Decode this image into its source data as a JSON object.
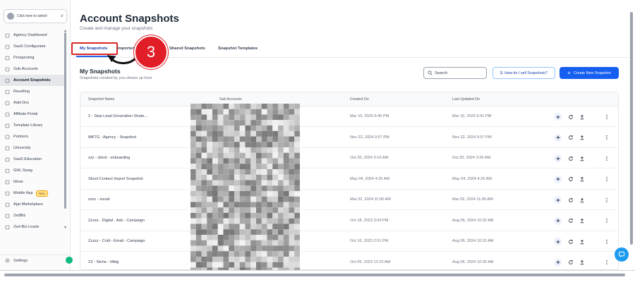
{
  "sidebar": {
    "switcher_label": "Click here to switch",
    "items": [
      {
        "label": "Agency Dashboard",
        "icon": "dashboard-icon"
      },
      {
        "label": "SaaS Configurator",
        "icon": "saas-icon"
      },
      {
        "label": "Prospecting",
        "icon": "prospecting-icon"
      },
      {
        "label": "Sub-Accounts",
        "icon": "sub-accounts-icon"
      },
      {
        "label": "Account Snapshots",
        "icon": "snapshots-icon",
        "active": true
      },
      {
        "label": "Reselling",
        "icon": "reselling-icon"
      },
      {
        "label": "Add-Ons",
        "icon": "add-ons-icon"
      },
      {
        "label": "Affiliate Portal",
        "icon": "affiliate-icon"
      },
      {
        "label": "Template Library",
        "icon": "template-library-icon"
      },
      {
        "label": "Partners",
        "icon": "partners-icon"
      },
      {
        "label": "University",
        "icon": "university-icon"
      },
      {
        "label": "SaaS Education",
        "icon": "saas-education-icon"
      },
      {
        "label": "GHL Swag",
        "icon": "swag-icon"
      },
      {
        "label": "Ideas",
        "icon": "ideas-icon"
      },
      {
        "label": "Mobile App",
        "icon": "mobile-app-icon",
        "badge": "New"
      },
      {
        "label": "App Marketplace",
        "icon": "marketplace-icon"
      },
      {
        "label": "ZedBiz",
        "icon": "zedbiz-icon"
      },
      {
        "label": "Zed-Biz-Leads",
        "icon": "zed-biz-leads-icon"
      }
    ],
    "settings_label": "Settings"
  },
  "header": {
    "title": "Account Snapshots",
    "subtitle": "Create and manage your snapshots"
  },
  "tabs": [
    {
      "label": "My Snapshots",
      "active": true
    },
    {
      "label": "Imported"
    },
    {
      "label": "Shared Snapshots"
    },
    {
      "label": "Snapshot Templates"
    }
  ],
  "annotation": {
    "step": "3",
    "highlight_color": "#dc2626"
  },
  "section": {
    "title": "My Snapshots",
    "subtitle": "Snapshots created by you shows up here"
  },
  "toolbar": {
    "search_placeholder": "Search",
    "how_label": "How do I sell Snapshots?",
    "create_label": "Create New Snapshot"
  },
  "table": {
    "columns": [
      "Snapshot Name",
      "Sub Accounts",
      "Created On",
      "Last Updated On"
    ],
    "rows": [
      {
        "name": "2 - Step Lead Generation Strate...",
        "created": "Mar 10, 2025 6:40 PM",
        "updated": "Mar 10, 2025 6:41 PM"
      },
      {
        "name": "MKTG - Agency - Snapshot",
        "created": "Nov 22, 2024 9:57 PM",
        "updated": "Nov 22, 2024 9:57 PM"
      },
      {
        "name": "zzz - client - onboarding",
        "created": "Oct 20, 2024 3:19 AM",
        "updated": "Oct 20, 2024 3:20 AM"
      },
      {
        "name": "Skool Contact Import Snapshot",
        "created": "May 04, 2024 4:25 AM",
        "updated": "May 04, 2024 4:25 AM"
      },
      {
        "name": "zzzz - social",
        "created": "Mar 02, 2024 11:00 AM",
        "updated": "Mar 02, 2024 11:00 AM"
      },
      {
        "name": "Zzzzz - Digital - Ads - Campaign",
        "created": "Oct 18, 2023 3:04 PM",
        "updated": "Aug 06, 2024 10:32 AM"
      },
      {
        "name": "Zzzzz - Cold - Email - Campaign",
        "created": "Oct 16, 2023 2:51 PM",
        "updated": "Aug 06, 2024 10:32 AM"
      },
      {
        "name": "ZZ - Niche - Mktg",
        "created": "Oct 05, 2023 12:25 AM",
        "updated": "Aug 06, 2024 10:36 AM"
      }
    ]
  },
  "colors": {
    "primary": "#155eef",
    "annotation_red": "#e11d28",
    "help_bubble": "#1d9bf0"
  }
}
